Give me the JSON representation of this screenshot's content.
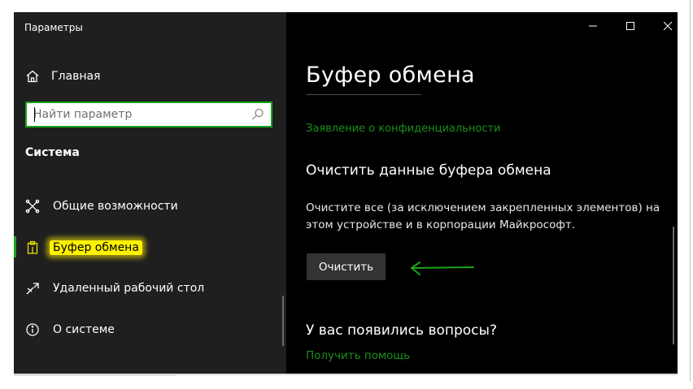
{
  "window": {
    "title": "Параметры"
  },
  "window_controls": {
    "minimize": "–",
    "maximize": "☐",
    "close": "✕"
  },
  "sidebar": {
    "home_label": "Главная",
    "search_placeholder": "Найти параметр",
    "section_title": "Система",
    "items": [
      {
        "label": "Общие возможности",
        "icon": "shared-experiences-icon",
        "active": false
      },
      {
        "label": "Буфер обмена",
        "icon": "clipboard-icon",
        "active": true
      },
      {
        "label": "Удаленный рабочий стол",
        "icon": "remote-desktop-icon",
        "active": false
      },
      {
        "label": "О системе",
        "icon": "info-icon",
        "active": false
      }
    ]
  },
  "main": {
    "title": "Буфер обмена",
    "privacy_link": "Заявление о конфиденциальности",
    "clear_section_title": "Очистить данные буфера обмена",
    "clear_description": "Очистите все (за исключением закрепленных элементов) на этом устройстве и в корпорации Майкрософт.",
    "clear_button": "Очистить",
    "faq_title": "У вас появились вопросы?",
    "help_link": "Получить помощь"
  },
  "colors": {
    "accent_green": "#1a8f1a",
    "highlight_yellow": "#fff200",
    "sidebar_bg": "#1f1f1f",
    "main_bg": "#000000"
  }
}
